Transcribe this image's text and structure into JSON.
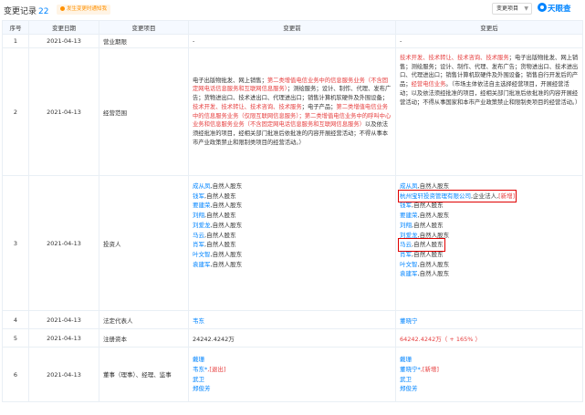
{
  "header": {
    "title": "变更记录",
    "count": "22",
    "tag": "发生变更时通知我",
    "select_label": "变更项目",
    "logo_text": "天眼查"
  },
  "columns": [
    "序号",
    "变更日期",
    "变更项目",
    "变更前",
    "变更后"
  ],
  "rows": [
    {
      "no": "1",
      "date": "2021-04-13",
      "item": "营业期限",
      "before": "-",
      "after": "-"
    },
    {
      "no": "2",
      "date": "2021-04-13",
      "item": "经营范围",
      "before_segments": [
        {
          "t": "电子出版物批发、网上销售；",
          "red": false
        },
        {
          "t": "第二类增值电信业务中的信息服务业务（不含固定网电话信息服务和互联网信息服务）",
          "red": true
        },
        {
          "t": "；测绘服务；设计、制作、代理、发布广告；货物进出口、技术进出口、代理进出口；销售计算机软硬件及外围设备；",
          "red": false
        },
        {
          "t": "技术开发、技术转让、技术咨询、技术服务",
          "red": true
        },
        {
          "t": "；电子产品；",
          "red": false
        },
        {
          "t": "第二类增值电信业务中的信息服务业务（仅限互联网信息服务）；第二类增值电信业务中的呼叫中心业务和信息服务业务（不含固定网电话信息服务和互联网信息服务）",
          "red": true
        },
        {
          "t": "以及依法须经批准的项目，经相关部门批准后依批准的内容开展经营活动；不得从事本市产业政策禁止和限制类项目的经营活动。）",
          "red": false
        }
      ],
      "after_segments": [
        {
          "t": "技术开发、技术转让、技术咨询、技术服务",
          "red": true
        },
        {
          "t": "；电子出版物批发、网上销售；测绘服务；设计、制作、代理、发布广告；货物进出口、技术进出口、代理进出口；销售计算机软硬件及外围设备；销售自行开发后的产品；",
          "red": false
        },
        {
          "t": "经营电信业务",
          "red": true
        },
        {
          "t": "。（市场主体依法自主选择经营项目，开展经营活动；以及依法须经批准的项目，经相关部门批准后依批准的内容开展经营活动；不得从事国家和本市产业政策禁止和限制类项目的经营活动。）",
          "red": false
        }
      ]
    },
    {
      "no": "3",
      "date": "2021-04-13",
      "item": "投资人",
      "before_people": [
        {
          "name": "成从凤",
          "role": ",自然人股东"
        },
        {
          "name": "钱军",
          "role": ",自然人股东"
        },
        {
          "name": "要建荣",
          "role": ",自然人股东"
        },
        {
          "name": "刘翔",
          "role": ",自然人股东"
        },
        {
          "name": "刘爱龙",
          "role": ",自然人股东"
        },
        {
          "name": "马云",
          "role": ",自然人股东"
        },
        {
          "name": "肖军",
          "role": ",自然人股东"
        },
        {
          "name": "叶文智",
          "role": ",自然人股东"
        },
        {
          "name": "袁建军",
          "role": ",自然人股东"
        }
      ],
      "after_people": [
        {
          "name": "成从凤",
          "role": ",自然人股东",
          "boxed": false,
          "new": ""
        },
        {
          "name": "杭州宝轩投资管理有限公司",
          "role": ",企业法人,",
          "boxed": true,
          "new": "[新增]"
        },
        {
          "name": "钱军",
          "role": ",自然人股东",
          "boxed": false,
          "new": ""
        },
        {
          "name": "要建荣",
          "role": ",自然人股东",
          "boxed": false,
          "new": ""
        },
        {
          "name": "刘翔",
          "role": ",自然人股东",
          "boxed": false,
          "new": ""
        },
        {
          "name": "刘爱龙",
          "role": ",自然人股东",
          "boxed": false,
          "new": ""
        },
        {
          "name": "马云",
          "role": ",自然人股东",
          "boxed": true,
          "new": ""
        },
        {
          "name": "肖军",
          "role": ",自然人股东",
          "boxed": false,
          "new": ""
        },
        {
          "name": "叶文智",
          "role": ",自然人股东",
          "boxed": false,
          "new": ""
        },
        {
          "name": "袁建军",
          "role": ",自然人股东",
          "boxed": false,
          "new": ""
        }
      ]
    },
    {
      "no": "4",
      "date": "2021-04-13",
      "item": "法定代表人",
      "before": "韦东",
      "after": "董晓宁"
    },
    {
      "no": "5",
      "date": "2021-04-13",
      "item": "注册资本",
      "before": "24242.4242万",
      "after": "64242.4242万（ + 165% ）"
    },
    {
      "no": "6",
      "date": "2021-04-13",
      "item": "董事（理事）、经理、监事",
      "before_people": [
        {
          "name": "戴珊",
          "mark": ""
        },
        {
          "name": "韦东*",
          "mark": ",[退出]"
        },
        {
          "name": "武卫",
          "mark": ""
        },
        {
          "name": "郑俊芳",
          "mark": ""
        }
      ],
      "after_people": [
        {
          "name": "戴珊",
          "mark": ""
        },
        {
          "name": "董晓宁*",
          "mark": ",[新增]"
        },
        {
          "name": "武卫",
          "mark": ""
        },
        {
          "name": "郑俊芳",
          "mark": ""
        }
      ]
    }
  ]
}
